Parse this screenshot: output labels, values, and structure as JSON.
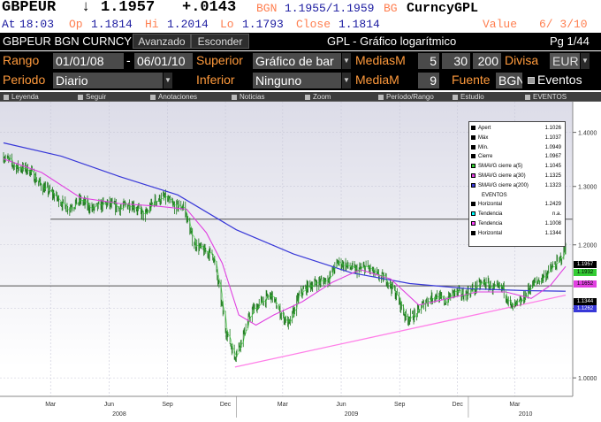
{
  "header": {
    "ticker": "GBPEUR",
    "arrow": "↓",
    "last": "1.1957",
    "change": "+.0143",
    "src1": "BGN",
    "bidask": "1.1955/1.1959",
    "src2": "BG",
    "security": "CurncyGPL",
    "at_label": "At",
    "time": "18:03",
    "op_label": "Op",
    "op_value": "1.1814",
    "hi_label": "Hi",
    "hi_value": "1.2014",
    "lo_label": "Lo",
    "lo_value": "1.1793",
    "close_label": "Close",
    "close_value": "1.1814",
    "value_label": "Value",
    "value_date": "6/ 3/10"
  },
  "titlebar": {
    "security": "GBPEUR BGN CURNCY",
    "tab_advanced": "Avanzado",
    "tab_hide": "Esconder",
    "chart_title": "GPL - Gráfico logarítmico",
    "page": "Pg 1/44"
  },
  "params": {
    "range_label": "Rango",
    "date_start": "01/01/08",
    "date_sep": "-",
    "date_end": "06/01/10",
    "upper_label": "Superior",
    "upper_value": "Gráfico de bar",
    "medias_label": "MediasM",
    "ma1": "5",
    "ma2": "30",
    "ma3": "200",
    "currency_label": "Divisa",
    "currency_value": "EUR",
    "period_label": "Periodo",
    "period_value": "Diario",
    "lower_label": "Inferior",
    "lower_value": "Ninguno",
    "mediam_label": "MediaM",
    "mediam_value": "9",
    "source_label": "Fuente",
    "source_value": "BGN",
    "events_label": "Eventos"
  },
  "chart_toolbar": [
    "Leyenda",
    "Seguir",
    "Anotaciones",
    "Noticias",
    "Zoom",
    "Período/Rango",
    "Estudio",
    "EVENTOS"
  ],
  "colors": {
    "bg_top": "#dcdce8",
    "bg_bottom": "#ffffff",
    "price": "#1e7a1e",
    "ma5": "#33cc33",
    "ma30": "#e040e0",
    "ma200": "#3838d8",
    "horizontal": "#505050",
    "trend": "#ff7fe8",
    "orange": "#ff9a3c",
    "brown": "#ff7f50"
  },
  "chart_data": {
    "type": "line",
    "title": "",
    "scale": "log",
    "ylim": [
      0.975,
      1.46
    ],
    "y_ticks": [
      "1.4000",
      "1.3000",
      "1.2000",
      "1.1000",
      "1.0000"
    ],
    "y_tick_values": [
      1.4,
      1.3,
      1.2,
      1.1,
      1.0
    ],
    "x_ticks": [
      "Mar",
      "Jun",
      "Sep",
      "Dec",
      "Mar",
      "Jun",
      "Sep",
      "Dec",
      "Mar"
    ],
    "x_years": [
      "2008",
      "2009",
      "2010"
    ],
    "x_range": [
      "2008-01-01",
      "2010-06-03"
    ],
    "price_series": [
      [
        "2008-01-01",
        1.355
      ],
      [
        "2008-01-20",
        1.335
      ],
      [
        "2008-02-10",
        1.33
      ],
      [
        "2008-03-01",
        1.3
      ],
      [
        "2008-03-20",
        1.285
      ],
      [
        "2008-04-10",
        1.262
      ],
      [
        "2008-05-01",
        1.275
      ],
      [
        "2008-05-20",
        1.26
      ],
      [
        "2008-06-10",
        1.27
      ],
      [
        "2008-07-01",
        1.262
      ],
      [
        "2008-07-20",
        1.27
      ],
      [
        "2008-08-10",
        1.248
      ],
      [
        "2008-08-25",
        1.275
      ],
      [
        "2008-09-10",
        1.28
      ],
      [
        "2008-09-25",
        1.265
      ],
      [
        "2008-10-10",
        1.265
      ],
      [
        "2008-10-25",
        1.205
      ],
      [
        "2008-11-10",
        1.19
      ],
      [
        "2008-11-25",
        1.185
      ],
      [
        "2008-12-05",
        1.13
      ],
      [
        "2008-12-15",
        1.07
      ],
      [
        "2008-12-29",
        1.03
      ],
      [
        "2009-01-10",
        1.055
      ],
      [
        "2009-01-25",
        1.095
      ],
      [
        "2009-02-10",
        1.11
      ],
      [
        "2009-02-25",
        1.12
      ],
      [
        "2009-03-10",
        1.095
      ],
      [
        "2009-03-25",
        1.075
      ],
      [
        "2009-04-10",
        1.12
      ],
      [
        "2009-04-25",
        1.135
      ],
      [
        "2009-05-10",
        1.14
      ],
      [
        "2009-05-25",
        1.145
      ],
      [
        "2009-06-10",
        1.172
      ],
      [
        "2009-06-25",
        1.165
      ],
      [
        "2009-07-10",
        1.158
      ],
      [
        "2009-07-25",
        1.165
      ],
      [
        "2009-08-10",
        1.15
      ],
      [
        "2009-08-25",
        1.145
      ],
      [
        "2009-09-10",
        1.12
      ],
      [
        "2009-09-25",
        1.085
      ],
      [
        "2009-10-10",
        1.09
      ],
      [
        "2009-10-25",
        1.11
      ],
      [
        "2009-11-10",
        1.12
      ],
      [
        "2009-11-25",
        1.11
      ],
      [
        "2009-12-10",
        1.125
      ],
      [
        "2009-12-25",
        1.12
      ],
      [
        "2010-01-10",
        1.13
      ],
      [
        "2010-01-25",
        1.14
      ],
      [
        "2010-02-10",
        1.13
      ],
      [
        "2010-02-25",
        1.13
      ],
      [
        "2010-03-10",
        1.1
      ],
      [
        "2010-03-25",
        1.11
      ],
      [
        "2010-04-10",
        1.135
      ],
      [
        "2010-04-25",
        1.145
      ],
      [
        "2010-05-10",
        1.16
      ],
      [
        "2010-05-25",
        1.175
      ],
      [
        "2010-06-03",
        1.196
      ]
    ],
    "ma30_series": [
      [
        "2008-01-01",
        1.35
      ],
      [
        "2008-03-01",
        1.325
      ],
      [
        "2008-05-01",
        1.28
      ],
      [
        "2008-07-01",
        1.27
      ],
      [
        "2008-09-01",
        1.265
      ],
      [
        "2008-10-15",
        1.26
      ],
      [
        "2008-11-15",
        1.22
      ],
      [
        "2008-12-10",
        1.17
      ],
      [
        "2009-01-05",
        1.09
      ],
      [
        "2009-02-01",
        1.075
      ],
      [
        "2009-03-01",
        1.09
      ],
      [
        "2009-04-15",
        1.11
      ],
      [
        "2009-06-01",
        1.14
      ],
      [
        "2009-07-15",
        1.16
      ],
      [
        "2009-09-01",
        1.145
      ],
      [
        "2009-10-15",
        1.105
      ],
      [
        "2009-12-01",
        1.115
      ],
      [
        "2010-01-15",
        1.125
      ],
      [
        "2010-03-01",
        1.125
      ],
      [
        "2010-04-10",
        1.115
      ],
      [
        "2010-05-10",
        1.135
      ],
      [
        "2010-06-03",
        1.165
      ]
    ],
    "ma200_series": [
      [
        "2008-01-01",
        1.38
      ],
      [
        "2008-04-01",
        1.355
      ],
      [
        "2008-07-01",
        1.318
      ],
      [
        "2008-10-01",
        1.285
      ],
      [
        "2009-01-01",
        1.225
      ],
      [
        "2009-04-01",
        1.185
      ],
      [
        "2009-07-01",
        1.155
      ],
      [
        "2009-10-01",
        1.138
      ],
      [
        "2010-01-01",
        1.13
      ],
      [
        "2010-04-01",
        1.127
      ],
      [
        "2010-06-03",
        1.126
      ]
    ],
    "horizontal_lines": [
      1.2429,
      1.1344
    ],
    "trend_line": [
      [
        "2008-12-30",
        1.015
      ],
      [
        "2010-06-03",
        1.12
      ]
    ],
    "legend": [
      {
        "name": "Apert",
        "value": "1.1026",
        "color": "#000000"
      },
      {
        "name": "Máx",
        "value": "1.1037",
        "color": "#000000"
      },
      {
        "name": "Mín.",
        "value": "1.0949",
        "color": "#000000"
      },
      {
        "name": "Cierre",
        "value": "1.0967",
        "color": "#000000"
      },
      {
        "name": "SMAVG cierre a(5)",
        "value": "1.1045",
        "color": "#33cc33"
      },
      {
        "name": "SMAVG cierre a(30)",
        "value": "1.1325",
        "color": "#e040e0"
      },
      {
        "name": "SMAVG cierre a(200)",
        "value": "1.1323",
        "color": "#3838d8"
      },
      {
        "name": "EVENTOS",
        "value": "",
        "color": ""
      },
      {
        "name": "Horizontal",
        "value": "1.2429",
        "color": "#000000"
      },
      {
        "name": "Tendencia",
        "value": "n.a.",
        "color": "#00ffff"
      },
      {
        "name": "Tendencia",
        "value": "1.1008",
        "color": "#ff44ff"
      },
      {
        "name": "Horizontal",
        "value": "1.1344",
        "color": "#000000"
      }
    ],
    "price_tags": [
      {
        "value": "1.1957",
        "color": "#000000",
        "text_color": "#ffffff"
      },
      {
        "value": "1.1932",
        "color": "#33cc33",
        "text_color": "#000000"
      },
      {
        "value": "1.1652",
        "color": "#e040e0",
        "text_color": "#000000"
      },
      {
        "value": "1.1344",
        "color": "#000000",
        "text_color": "#ffffff"
      },
      {
        "value": "1.1262",
        "color": "#3838d8",
        "text_color": "#ffffff"
      }
    ]
  }
}
